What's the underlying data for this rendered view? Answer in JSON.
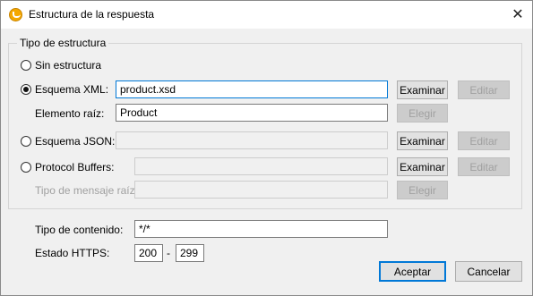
{
  "window": {
    "title": "Estructura de la respuesta",
    "close_glyph": "✕"
  },
  "group": {
    "label": "Tipo de estructura"
  },
  "options": {
    "sin_estructura": {
      "label": "Sin estructura",
      "checked": false
    },
    "esquema_xml": {
      "label": "Esquema XML:",
      "value": "product.xsd",
      "checked": true
    },
    "elemento_raiz": {
      "label": "Elemento raíz:",
      "value": "Product"
    },
    "esquema_json": {
      "label": "Esquema JSON:",
      "value": "",
      "checked": false
    },
    "protocol_buffers": {
      "label": "Protocol Buffers:",
      "value": "",
      "checked": false
    },
    "tipo_mensaje_raiz": {
      "label": "Tipo de mensaje raíz:",
      "value": ""
    }
  },
  "buttons": {
    "examinar": "Examinar",
    "editar": "Editar",
    "elegir": "Elegir",
    "aceptar": "Aceptar",
    "cancelar": "Cancelar"
  },
  "content_type": {
    "label": "Tipo de contenido:",
    "value": "*/*"
  },
  "https_status": {
    "label": "Estado HTTPS:",
    "from": "200",
    "separator": "-",
    "to": "299"
  }
}
